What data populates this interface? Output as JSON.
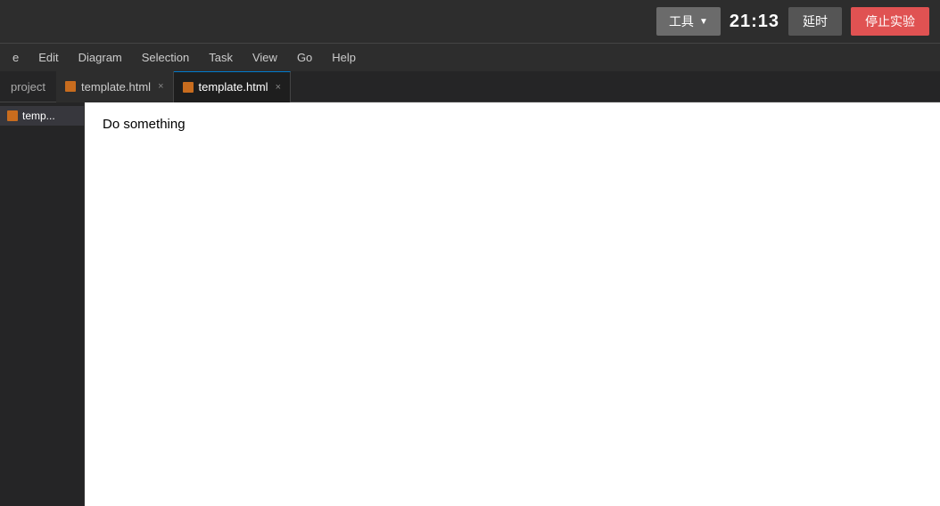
{
  "topbar": {
    "tool_label": "工具",
    "tool_arrow": "▼",
    "timer": "21:13",
    "delay_label": "延时",
    "stop_label": "停止实验"
  },
  "menubar": {
    "items": [
      {
        "label": "e"
      },
      {
        "label": "Edit"
      },
      {
        "label": "Diagram"
      },
      {
        "label": "Selection"
      },
      {
        "label": "Task"
      },
      {
        "label": "View"
      },
      {
        "label": "Go"
      },
      {
        "label": "Help"
      }
    ]
  },
  "tabs": {
    "project_label": "project",
    "tab1": {
      "name": "template.html",
      "close": "×"
    },
    "tab2": {
      "name": "template.html",
      "close": "×"
    }
  },
  "sidebar": {
    "item": "temp..."
  },
  "editor": {
    "content": "Do something"
  }
}
